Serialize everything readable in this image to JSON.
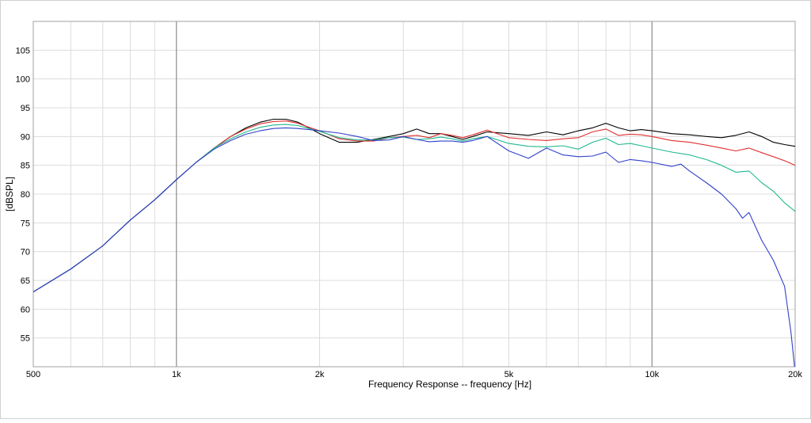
{
  "chart_data": {
    "type": "line",
    "title": "",
    "xlabel": "Frequency Response -- frequency [Hz]",
    "ylabel": "[dBSPL]",
    "x_scale": "log",
    "xlim": [
      500,
      20000
    ],
    "ylim": [
      50,
      110
    ],
    "grid": true,
    "x_ticks": [
      {
        "value": 500,
        "label": "500"
      },
      {
        "value": 1000,
        "label": "1k"
      },
      {
        "value": 2000,
        "label": "2k"
      },
      {
        "value": 5000,
        "label": "5k"
      },
      {
        "value": 10000,
        "label": "10k"
      },
      {
        "value": 20000,
        "label": "20k"
      }
    ],
    "y_ticks": [
      55,
      60,
      65,
      70,
      75,
      80,
      85,
      90,
      95,
      100,
      105
    ],
    "series": [
      {
        "color": "#000000",
        "points": [
          [
            500,
            63
          ],
          [
            600,
            67
          ],
          [
            700,
            71
          ],
          [
            800,
            75.5
          ],
          [
            900,
            79
          ],
          [
            1000,
            82.5
          ],
          [
            1100,
            85.5
          ],
          [
            1200,
            88
          ],
          [
            1300,
            90
          ],
          [
            1400,
            91.5
          ],
          [
            1500,
            92.5
          ],
          [
            1600,
            93
          ],
          [
            1700,
            93
          ],
          [
            1800,
            92.5
          ],
          [
            1900,
            91.5
          ],
          [
            2000,
            90.5
          ],
          [
            2200,
            89
          ],
          [
            2400,
            89
          ],
          [
            2600,
            89.5
          ],
          [
            2800,
            90
          ],
          [
            3000,
            90.5
          ],
          [
            3200,
            91.3
          ],
          [
            3400,
            90.5
          ],
          [
            3600,
            90.5
          ],
          [
            3800,
            90
          ],
          [
            4000,
            89.5
          ],
          [
            4200,
            90
          ],
          [
            4500,
            90.8
          ],
          [
            5000,
            90.5
          ],
          [
            5500,
            90.2
          ],
          [
            6000,
            90.8
          ],
          [
            6500,
            90.3
          ],
          [
            7000,
            91
          ],
          [
            7500,
            91.5
          ],
          [
            8000,
            92.3
          ],
          [
            8500,
            91.5
          ],
          [
            9000,
            91
          ],
          [
            9500,
            91.2
          ],
          [
            10000,
            91
          ],
          [
            11000,
            90.5
          ],
          [
            12000,
            90.3
          ],
          [
            13000,
            90
          ],
          [
            14000,
            89.8
          ],
          [
            15000,
            90.2
          ],
          [
            16000,
            90.8
          ],
          [
            17000,
            90
          ],
          [
            18000,
            89
          ],
          [
            19000,
            88.6
          ],
          [
            20000,
            88.3
          ]
        ]
      },
      {
        "color": "#e03030",
        "points": [
          [
            500,
            63
          ],
          [
            600,
            67
          ],
          [
            700,
            71
          ],
          [
            800,
            75.5
          ],
          [
            900,
            79
          ],
          [
            1000,
            82.5
          ],
          [
            1100,
            85.5
          ],
          [
            1200,
            88
          ],
          [
            1300,
            90
          ],
          [
            1400,
            91.3
          ],
          [
            1500,
            92.2
          ],
          [
            1600,
            92.6
          ],
          [
            1700,
            92.7
          ],
          [
            1800,
            92.3
          ],
          [
            1900,
            91.6
          ],
          [
            2000,
            91
          ],
          [
            2200,
            89.6
          ],
          [
            2400,
            89.2
          ],
          [
            2600,
            89.2
          ],
          [
            2800,
            89.8
          ],
          [
            3000,
            90
          ],
          [
            3200,
            90.2
          ],
          [
            3400,
            89.8
          ],
          [
            3600,
            90.5
          ],
          [
            3800,
            90.2
          ],
          [
            4000,
            89.8
          ],
          [
            4200,
            90.3
          ],
          [
            4500,
            91.1
          ],
          [
            5000,
            89.8
          ],
          [
            5500,
            89.5
          ],
          [
            6000,
            89.3
          ],
          [
            6500,
            89.6
          ],
          [
            7000,
            89.8
          ],
          [
            7500,
            90.8
          ],
          [
            8000,
            91.3
          ],
          [
            8500,
            90.2
          ],
          [
            9000,
            90.4
          ],
          [
            9500,
            90.3
          ],
          [
            10000,
            90
          ],
          [
            11000,
            89.3
          ],
          [
            12000,
            89
          ],
          [
            13000,
            88.5
          ],
          [
            14000,
            88
          ],
          [
            15000,
            87.5
          ],
          [
            16000,
            88
          ],
          [
            17000,
            87.2
          ],
          [
            18000,
            86.5
          ],
          [
            19000,
            85.8
          ],
          [
            20000,
            85
          ]
        ]
      },
      {
        "color": "#20b890",
        "points": [
          [
            500,
            63
          ],
          [
            600,
            67
          ],
          [
            700,
            71
          ],
          [
            800,
            75.5
          ],
          [
            900,
            79
          ],
          [
            1000,
            82.5
          ],
          [
            1100,
            85.5
          ],
          [
            1200,
            88
          ],
          [
            1300,
            89.6
          ],
          [
            1400,
            90.8
          ],
          [
            1500,
            91.6
          ],
          [
            1600,
            92
          ],
          [
            1700,
            92.1
          ],
          [
            1800,
            91.9
          ],
          [
            1900,
            91.4
          ],
          [
            2000,
            90.9
          ],
          [
            2200,
            89.8
          ],
          [
            2400,
            89.4
          ],
          [
            2600,
            89.4
          ],
          [
            2800,
            89.8
          ],
          [
            3000,
            89.9
          ],
          [
            3200,
            89.5
          ],
          [
            3400,
            89.6
          ],
          [
            3600,
            89.9
          ],
          [
            3800,
            89.6
          ],
          [
            4000,
            89.2
          ],
          [
            4200,
            89.6
          ],
          [
            4500,
            90
          ],
          [
            5000,
            88.8
          ],
          [
            5500,
            88.3
          ],
          [
            6000,
            88.2
          ],
          [
            6500,
            88.4
          ],
          [
            7000,
            87.8
          ],
          [
            7500,
            89
          ],
          [
            8000,
            89.7
          ],
          [
            8500,
            88.6
          ],
          [
            9000,
            88.8
          ],
          [
            9500,
            88.4
          ],
          [
            10000,
            88
          ],
          [
            11000,
            87.3
          ],
          [
            12000,
            86.8
          ],
          [
            13000,
            86
          ],
          [
            14000,
            85
          ],
          [
            15000,
            83.8
          ],
          [
            16000,
            84
          ],
          [
            17000,
            82
          ],
          [
            18000,
            80.5
          ],
          [
            19000,
            78.5
          ],
          [
            20000,
            77
          ]
        ]
      },
      {
        "color": "#3040c8",
        "points": [
          [
            500,
            63
          ],
          [
            600,
            67
          ],
          [
            700,
            71
          ],
          [
            800,
            75.5
          ],
          [
            900,
            79
          ],
          [
            1000,
            82.5
          ],
          [
            1100,
            85.5
          ],
          [
            1200,
            87.8
          ],
          [
            1300,
            89.3
          ],
          [
            1400,
            90.4
          ],
          [
            1500,
            91
          ],
          [
            1600,
            91.4
          ],
          [
            1700,
            91.5
          ],
          [
            1800,
            91.4
          ],
          [
            1900,
            91.2
          ],
          [
            2000,
            91
          ],
          [
            2200,
            90.6
          ],
          [
            2400,
            90
          ],
          [
            2600,
            89.3
          ],
          [
            2800,
            89.4
          ],
          [
            3000,
            90
          ],
          [
            3200,
            89.5
          ],
          [
            3400,
            89.1
          ],
          [
            3600,
            89.2
          ],
          [
            3800,
            89.2
          ],
          [
            4000,
            89
          ],
          [
            4200,
            89.3
          ],
          [
            4500,
            90
          ],
          [
            5000,
            87.5
          ],
          [
            5500,
            86.2
          ],
          [
            6000,
            88
          ],
          [
            6500,
            86.8
          ],
          [
            7000,
            86.5
          ],
          [
            7500,
            86.6
          ],
          [
            8000,
            87.3
          ],
          [
            8500,
            85.5
          ],
          [
            9000,
            86
          ],
          [
            9500,
            85.8
          ],
          [
            10000,
            85.5
          ],
          [
            11000,
            84.8
          ],
          [
            11500,
            85.2
          ],
          [
            12000,
            84
          ],
          [
            13000,
            82
          ],
          [
            14000,
            80
          ],
          [
            15000,
            77.5
          ],
          [
            15500,
            75.8
          ],
          [
            16000,
            76.8
          ],
          [
            17000,
            72
          ],
          [
            18000,
            68.5
          ],
          [
            19000,
            64
          ],
          [
            19600,
            56
          ],
          [
            20000,
            49
          ]
        ]
      }
    ]
  }
}
